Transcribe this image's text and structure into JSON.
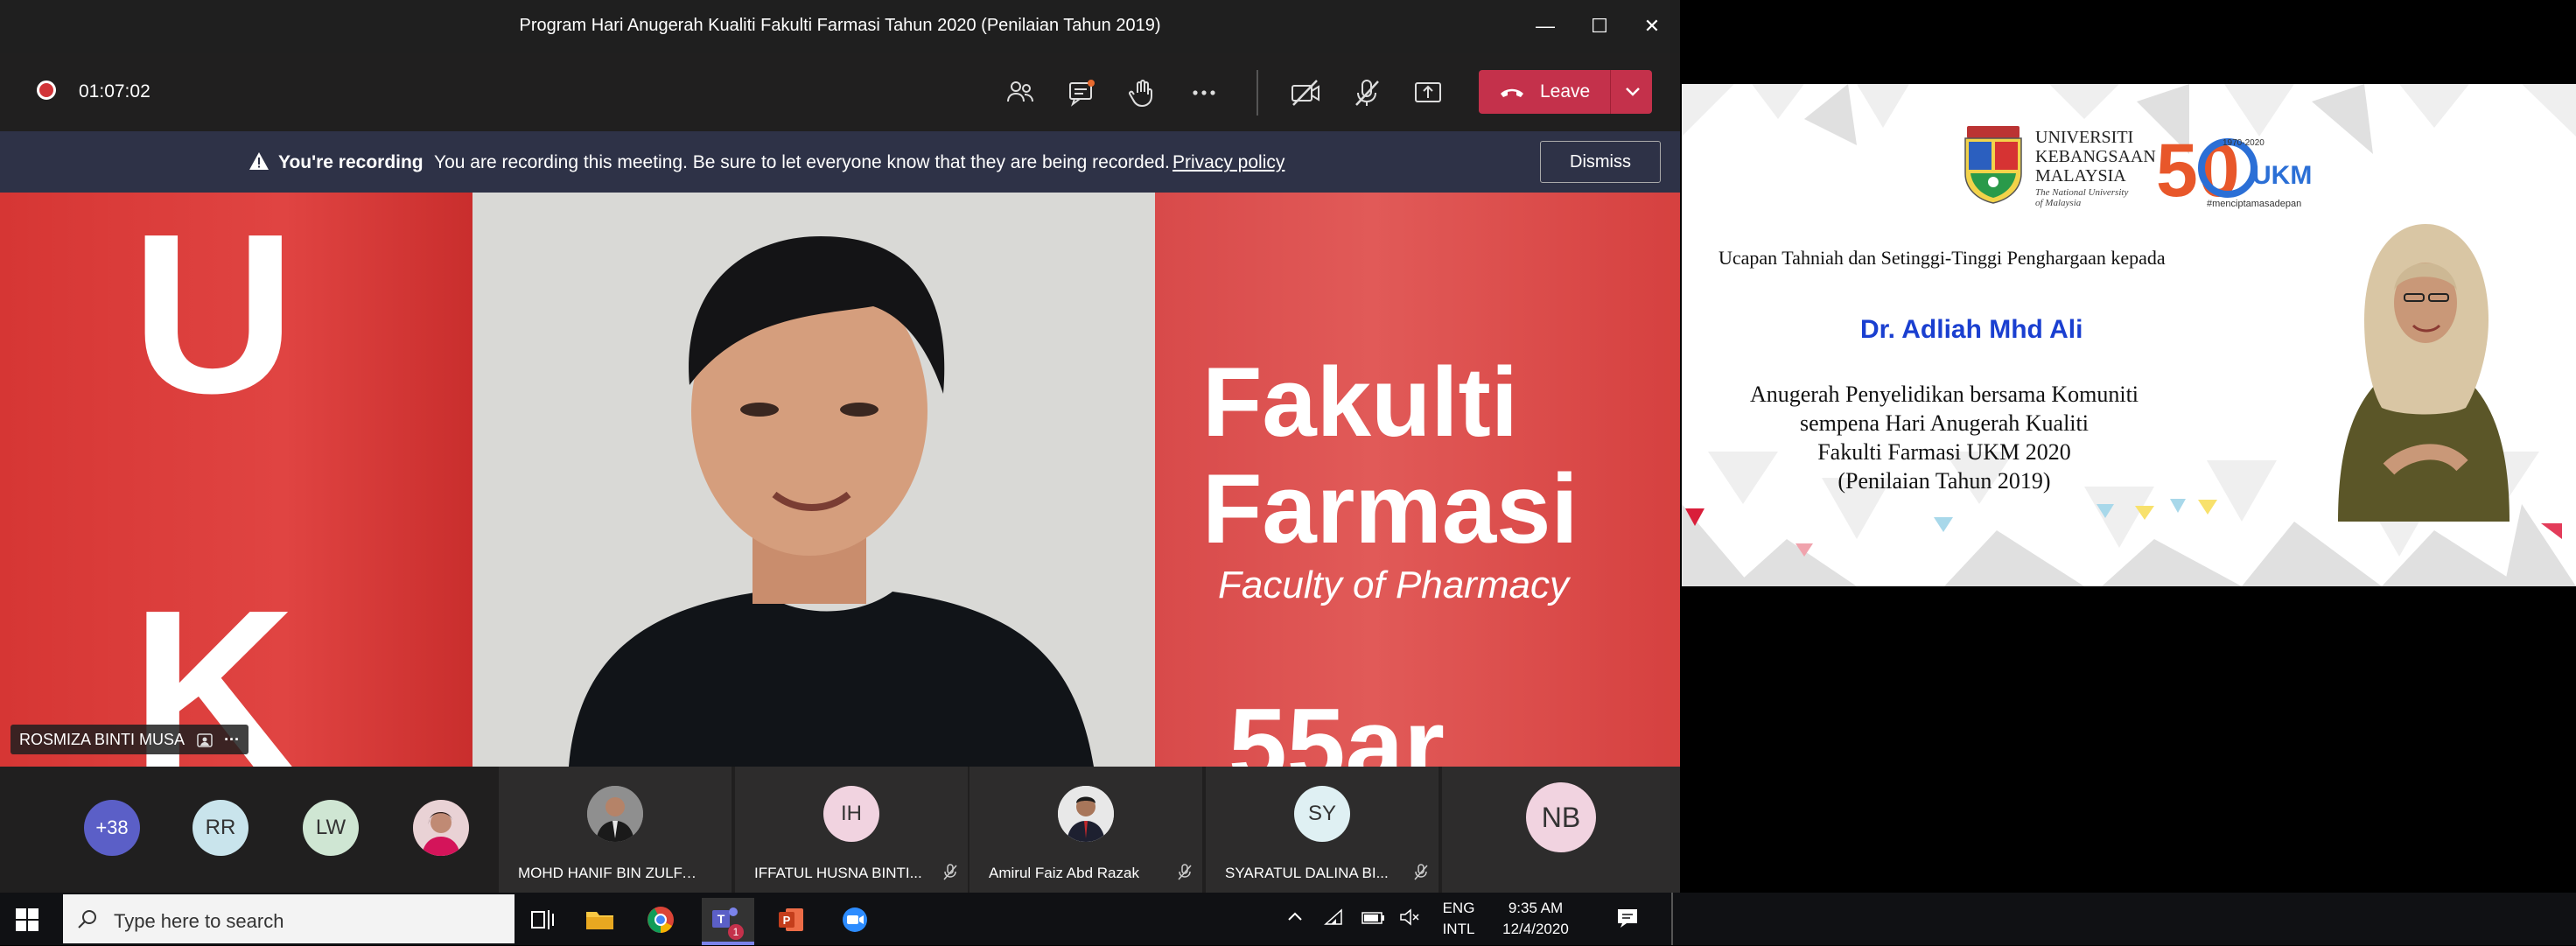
{
  "window": {
    "title": "Program Hari Anugerah Kualiti Fakulti Farmasi Tahun 2020 (Penilaian Tahun 2019)",
    "minimize": "—",
    "maximize": "☐",
    "close": "✕"
  },
  "toolbar": {
    "recording_time": "01:07:02",
    "leave_label": "Leave"
  },
  "banner": {
    "title": "You're recording",
    "message": "You are recording this meeting. Be sure to let everyone know that they are being recorded.",
    "link": "Privacy policy",
    "dismiss": "Dismiss"
  },
  "video": {
    "speaker_name": "ROSMIZA BINTI MUSA",
    "backdrop_left_letters": [
      "U",
      "K"
    ],
    "backdrop_right_title1": "Fakulti",
    "backdrop_right_title2": "Farmasi",
    "backdrop_right_sub": "Faculty of Pharmacy",
    "backdrop_right_fragment": "55ar"
  },
  "participants": {
    "overflow": "+38",
    "pills": [
      {
        "initials": "RR",
        "color": "#c9e4ec"
      },
      {
        "initials": "LW",
        "color": "#cfe6d3"
      }
    ],
    "tiles": [
      {
        "name": "MOHD HANIF BIN ZULFAK...",
        "initials": ""
      },
      {
        "name": "IFFATUL HUSNA BINTI...",
        "initials": "IH"
      },
      {
        "name": "Amirul Faiz Abd Razak",
        "initials": ""
      },
      {
        "name": "SYARATUL DALINA BI...",
        "initials": "SY"
      }
    ],
    "last_tile": "NB"
  },
  "taskbar": {
    "search_placeholder": "Type here to search",
    "language": "ENG",
    "layout": "INTL",
    "time": "9:35 AM",
    "date": "12/4/2020",
    "teams_badge": "1"
  },
  "slide": {
    "university_lines": [
      "UNIVERSITI",
      "KEBANGSAAN",
      "MALAYSIA"
    ],
    "university_tag": [
      "The National University",
      "of Malaysia"
    ],
    "anniv_years": "1970-2020",
    "anniv_brand": "UKM",
    "anniv_number": "50",
    "anniv_hashtag": "#menciptamasadepan",
    "greeting": "Ucapan Tahniah dan Setinggi-Tinggi Penghargaan kepada",
    "recipient": "Dr. Adliah Mhd Ali",
    "award_lines": [
      "Anugerah Penyelidikan bersama Komuniti",
      "sempena Hari Anugerah Kualiti",
      "Fakulti Farmasi UKM 2020",
      "(Penilaian Tahun 2019)"
    ]
  }
}
